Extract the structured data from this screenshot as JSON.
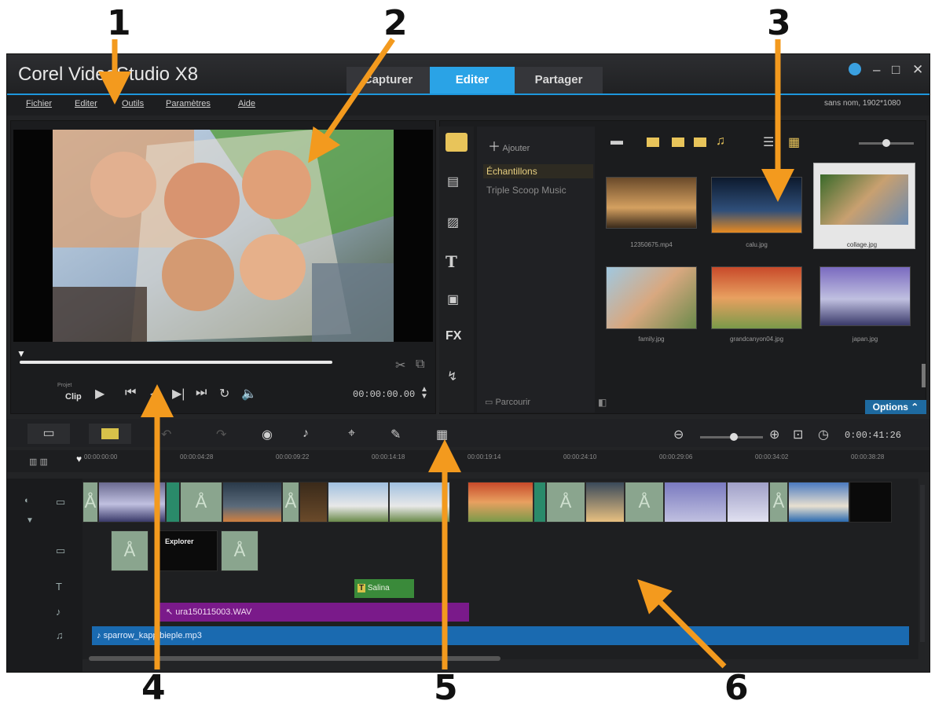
{
  "callouts": [
    "1",
    "2",
    "3",
    "4",
    "5",
    "6"
  ],
  "app": {
    "title": "Corel VideoStudio X8",
    "tabs": [
      {
        "label": "Capturer",
        "active": false
      },
      {
        "label": "Editer",
        "active": true
      },
      {
        "label": "Partager",
        "active": false
      }
    ],
    "menu": [
      "Fichier",
      "Editer",
      "Outils",
      "Paramètres",
      "Aide"
    ],
    "project_info": "sans nom, 1902*1080",
    "window_icons": [
      "help-icon",
      "minimize-icon",
      "maximize-icon",
      "close-icon"
    ]
  },
  "player": {
    "mode_labels": {
      "project": "Projet",
      "clip": "Clip"
    },
    "timecode": "00:00:00.00",
    "controls": [
      "play-icon",
      "prev-icon",
      "step-back-icon",
      "step-forward-icon",
      "end-icon",
      "repeat-icon",
      "volume-icon"
    ]
  },
  "library": {
    "add_label": "Ajouter",
    "folders": [
      "Échantillons",
      "Triple Scoop Music"
    ],
    "browse_label": "Parcourir",
    "options_label": "Options",
    "side_icons": [
      "media-icon",
      "instant-project-icon",
      "transition-icon",
      "title-icon",
      "graphic-icon",
      "filter-icon",
      "path-icon"
    ],
    "side_fx_label": "FX",
    "thumbnails": [
      {
        "label": "12350675.mp4",
        "colors": [
          "#6a4a2a",
          "#d4a060",
          "#3a2a1a"
        ]
      },
      {
        "label": "calu.jpg",
        "colors": [
          "#0d1a2e",
          "#2f4f7a",
          "#e88a20"
        ]
      },
      {
        "label": "collage.jpg",
        "colors": [
          "#3a6a2a",
          "#c8a070",
          "#6a8ab0"
        ]
      },
      {
        "label": "family.jpg",
        "colors": [
          "#a0c8e0",
          "#d8a880",
          "#6a8a4a"
        ]
      },
      {
        "label": "grandcanyon04.jpg",
        "colors": [
          "#c84a2a",
          "#e8a060",
          "#7a9a4a"
        ]
      },
      {
        "label": "japan.jpg",
        "colors": [
          "#7a6ac0",
          "#c0c0e0",
          "#3a3a6a"
        ]
      }
    ]
  },
  "timeline": {
    "timecode": "0:00:41:26",
    "ruler": [
      "00:00:00:00",
      "00:00:04:28",
      "00:00:09:22",
      "00:00:14:18",
      "00:00:19:14",
      "00:00:24:10",
      "00:00:29:06",
      "00:00:34:02",
      "00:00:38:28"
    ],
    "title_clip_text": "Explorer",
    "title_track_clip": "Salina",
    "voice_clip": "ura150115003.WAV",
    "music_clip": "sparrow_kappibieple.mp3",
    "video_clip_colors": [
      "#6a6a90",
      "#2a3a4a",
      "#a0c0e0",
      "#d08040",
      "#7a7ac0",
      "#a0a0c8",
      "#e8e0d0"
    ]
  }
}
